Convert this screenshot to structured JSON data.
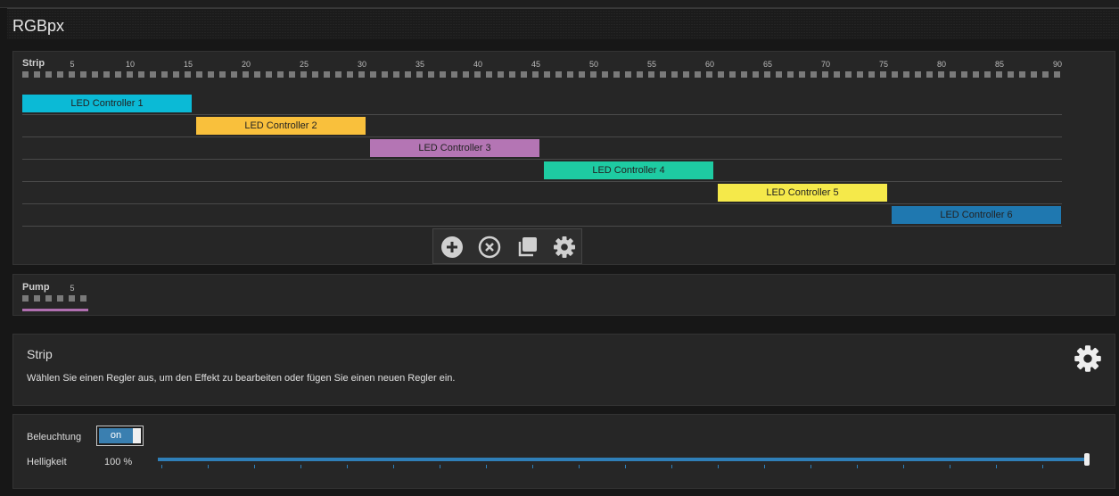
{
  "app": {
    "title": "RGBpx"
  },
  "strip": {
    "label": "Strip",
    "ticks": [
      "5",
      "10",
      "15",
      "20",
      "25",
      "30",
      "35",
      "40",
      "45",
      "50",
      "55",
      "60",
      "65",
      "70",
      "75",
      "80",
      "85",
      "90"
    ],
    "controllers": [
      {
        "label": "LED Controller 1",
        "color": "#0bbad6"
      },
      {
        "label": "LED Controller 2",
        "color": "#f9c03c"
      },
      {
        "label": "LED Controller 3",
        "color": "#b475b4"
      },
      {
        "label": "LED Controller 4",
        "color": "#1ecba2"
      },
      {
        "label": "LED Controller 5",
        "color": "#f5e94a"
      },
      {
        "label": "LED Controller 6",
        "color": "#1f78b0"
      }
    ],
    "toolbar": {
      "icons": [
        "plus-circle-icon",
        "x-circle-icon",
        "copy-icon",
        "gear-icon"
      ]
    }
  },
  "pump": {
    "label": "Pump",
    "tick": "5",
    "color": "#b06fb0"
  },
  "info": {
    "title": "Strip",
    "text": "Wählen Sie einen Regler aus, um den Effekt zu bearbeiten oder fügen Sie einen neuen Regler ein."
  },
  "lighting": {
    "label": "Beleuchtung",
    "toggle_label": "on",
    "toggle_on": true,
    "brightness_label": "Helligkeit",
    "brightness_value": "100 %",
    "brightness_fraction": 1.0
  },
  "colors": {
    "accent": "#2f7fb8"
  }
}
